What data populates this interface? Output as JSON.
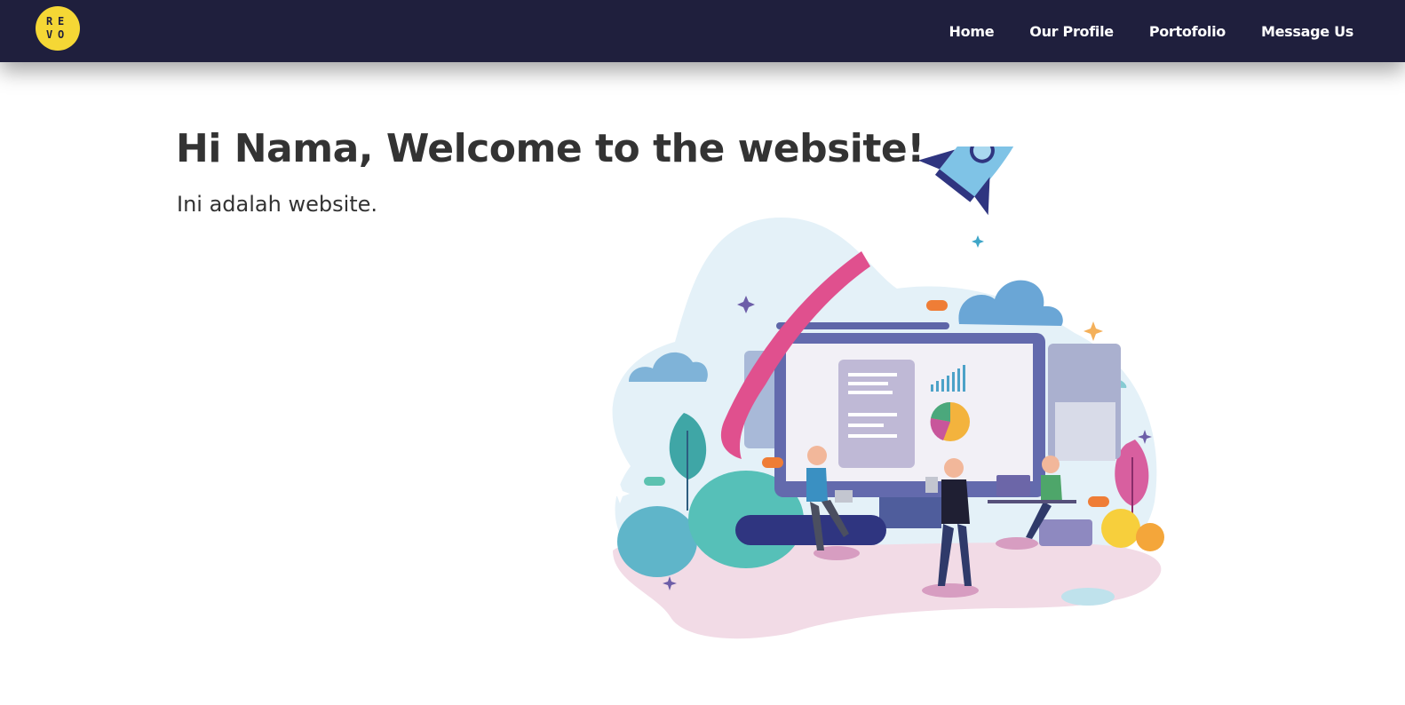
{
  "nav": {
    "logo_letters": [
      "R",
      "E",
      "V",
      "O"
    ],
    "links": [
      "Home",
      "Our Profile",
      "Portofolio",
      "Message Us"
    ]
  },
  "hero": {
    "title": "Hi Nama, Welcome to the website!",
    "subtitle": "Ini adalah website."
  },
  "colors": {
    "navbar": "#1f1f3d",
    "logo": "#f5d735",
    "text": "#333333"
  }
}
